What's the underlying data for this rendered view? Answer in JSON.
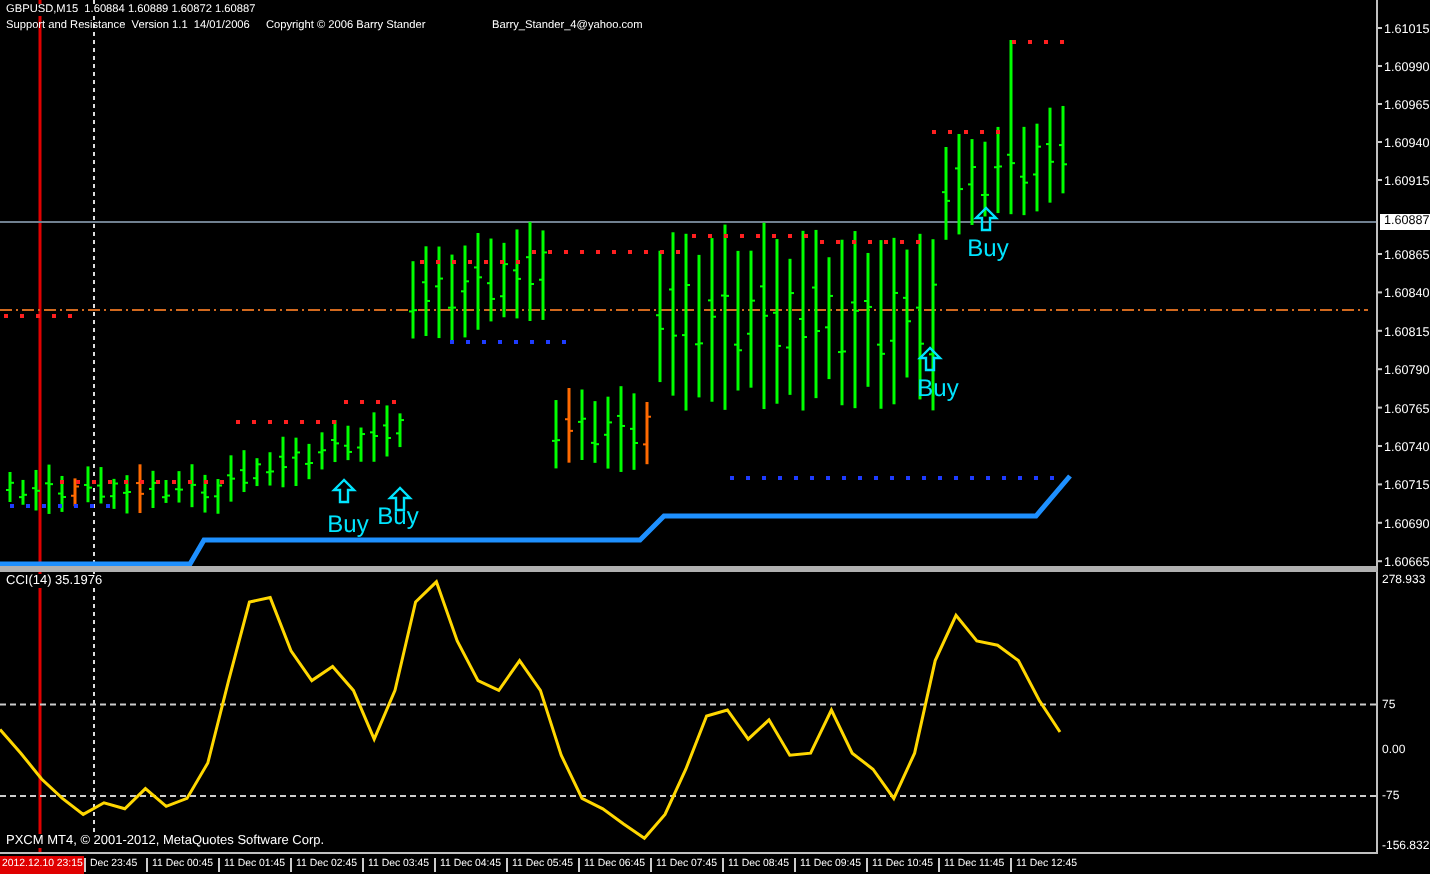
{
  "chart": {
    "symbol_info": "GBPUSD,M15  1.60884 1.60889 1.60872 1.60887",
    "indicator_title": "Support and Resistance  Version 1.1  14/01/2006",
    "copyright": "Copyright © 2006 Barry Stander",
    "email": "Barry_Stander_4@yahoo.com",
    "price_axis": [
      "1.61015",
      "1.60990",
      "1.60965",
      "1.60940",
      "1.60915",
      "1.60865",
      "1.60840",
      "1.60815",
      "1.60790",
      "1.60765",
      "1.60740",
      "1.60715",
      "1.60690",
      "1.60665"
    ],
    "current_price": "1.60887",
    "signals": [
      {
        "label": "Buy"
      },
      {
        "label": "Buy"
      },
      {
        "label": "Buy"
      },
      {
        "label": "Buy"
      }
    ]
  },
  "cci": {
    "label": "CCI(14) 35.1976",
    "chart_data": {
      "type": "line",
      "series": [
        {
          "color": "#ffd700",
          "values": [
            34,
            -5,
            -47,
            -79,
            -105,
            -86,
            -96,
            -63,
            -92,
            -79,
            -21,
            114,
            243,
            250,
            163,
            114,
            137,
            98,
            18,
            98,
            243,
            276,
            179,
            114,
            98,
            147,
            98,
            -8,
            -79,
            -96,
            -121,
            -144,
            -105,
            -31,
            56,
            66,
            18,
            50,
            -8,
            -5,
            66,
            -5,
            -31,
            -79,
            -5,
            147,
            221,
            179,
            172,
            147,
            82,
            30
          ]
        }
      ],
      "ylim": [
        -170,
        292
      ],
      "yticks": [
        {
          "value": 278.933,
          "label": "278.933"
        },
        {
          "value": 75,
          "label": "75"
        },
        {
          "value": 0,
          "label": "0.00"
        },
        {
          "value": -75,
          "label": "-75"
        },
        {
          "value": -156.832,
          "label": "-156.832"
        }
      ]
    }
  },
  "footer": "PXCM MT4, © 2001-2012, MetaQuotes Software Corp.",
  "time_axis": {
    "cursor_time": "2012.12.10 23:15",
    "labels": [
      "Dec 23:45",
      "11 Dec 00:45",
      "11 Dec 01:45",
      "11 Dec 02:45",
      "11 Dec 03:45",
      "11 Dec 04:45",
      "11 Dec 05:45",
      "11 Dec 06:45",
      "11 Dec 07:45",
      "11 Dec 08:45",
      "11 Dec 09:45",
      "11 Dec 10:45",
      "11 Dec 11:45",
      "11 Dec 12:45"
    ]
  }
}
